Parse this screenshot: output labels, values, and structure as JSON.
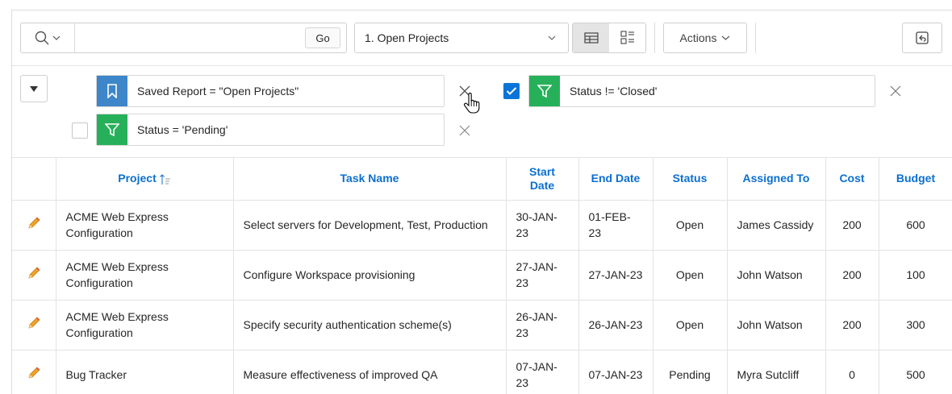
{
  "toolbar": {
    "search_value": "",
    "go_label": "Go",
    "selected_report": "1. Open Projects",
    "actions_label": "Actions"
  },
  "filters": [
    {
      "type": "saved-report",
      "text": "Saved Report = \"Open Projects\"",
      "enabled": true
    },
    {
      "type": "filter",
      "text": "Status != 'Closed'",
      "enabled": true
    },
    {
      "type": "filter",
      "text": "Status = 'Pending'",
      "enabled": false
    }
  ],
  "table": {
    "columns": [
      {
        "label": "Project",
        "sorted": "ascending"
      },
      {
        "label": "Task Name"
      },
      {
        "label": "Start Date"
      },
      {
        "label": "End Date"
      },
      {
        "label": "Status"
      },
      {
        "label": "Assigned To"
      },
      {
        "label": "Cost"
      },
      {
        "label": "Budget"
      }
    ],
    "rows": [
      {
        "project": "ACME Web Express Configuration",
        "task": "Select servers for Development, Test, Production",
        "start": "30-JAN-23",
        "end": "01-FEB-23",
        "status": "Open",
        "assigned": "James Cassidy",
        "cost": "200",
        "budget": "600"
      },
      {
        "project": "ACME Web Express Configuration",
        "task": "Configure Workspace provisioning",
        "start": "27-JAN-23",
        "end": "27-JAN-23",
        "status": "Open",
        "assigned": "John Watson",
        "cost": "200",
        "budget": "100"
      },
      {
        "project": "ACME Web Express Configuration",
        "task": "Specify security authentication scheme(s)",
        "start": "26-JAN-23",
        "end": "26-JAN-23",
        "status": "Open",
        "assigned": "John Watson",
        "cost": "200",
        "budget": "300"
      },
      {
        "project": "Bug Tracker",
        "task": "Measure effectiveness of improved QA",
        "start": "07-JAN-23",
        "end": "07-JAN-23",
        "status": "Pending",
        "assigned": "Myra Sutcliff",
        "cost": "0",
        "budget": "500"
      }
    ]
  },
  "colors": {
    "link": "#0b6fd0",
    "saved_badge": "#3d86c9",
    "filter_badge": "#27b05a",
    "checkbox_on": "#0a74d8",
    "edit_pencil": "#f0a229"
  },
  "icons": [
    "search-icon",
    "chevron-down-icon",
    "grid-view-icon",
    "detail-view-icon",
    "reset-icon",
    "triangle-down-icon",
    "bookmark-icon",
    "funnel-icon",
    "close-icon",
    "check-icon",
    "edit-pencil-icon",
    "sort-ascending-icon",
    "hand-cursor-icon"
  ]
}
